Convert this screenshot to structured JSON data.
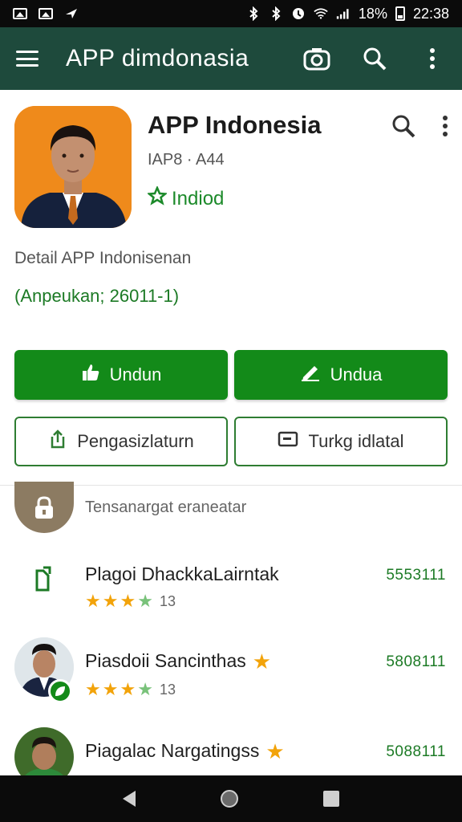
{
  "status_bar": {
    "battery": "18%",
    "time": "22:38"
  },
  "app_bar": {
    "title": "APP dimdonasia"
  },
  "app": {
    "name": "APP Indonesia",
    "meta": "IAP8 · A44",
    "developer": "Indiod"
  },
  "detail": {
    "title": "Detail APP Indonisenan",
    "subtitle": "(Anpeukan; 26011-1)"
  },
  "buttons": {
    "primary_left": "Undun",
    "primary_right": "Undua",
    "secondary_left": "Pengasizlaturn",
    "secondary_right": "Turkg idlatal"
  },
  "section": {
    "label": "Tensanargat eraneatar"
  },
  "list": [
    {
      "title": "Plagoi DhackkaLairntak",
      "rating": "13",
      "value": "5553111",
      "icon": "file-share-icon"
    },
    {
      "title": "Piasdoii Sancinthas",
      "rating": "13",
      "value": "5808111",
      "icon": "person-avatar",
      "badge": "star-icon"
    },
    {
      "title": "Piagalac Nargatingss",
      "rating": "",
      "value": "5088111",
      "icon": "person-avatar",
      "badge": "star-icon"
    }
  ],
  "colors": {
    "app_bar": "#1e4a3c",
    "primary_green": "#138a19",
    "accent_orange": "#ef8a1b",
    "star": "#f2a30a"
  }
}
